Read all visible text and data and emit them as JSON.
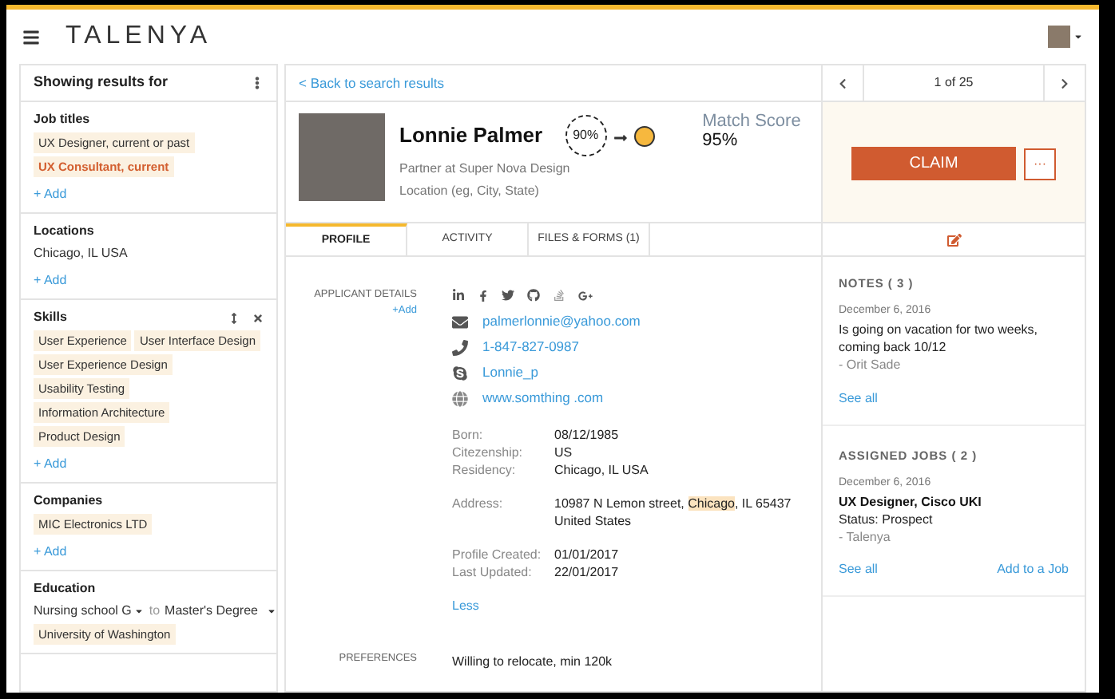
{
  "header": {
    "logo": "TALENYA"
  },
  "filters": {
    "title": "Showing results for",
    "sections": [
      {
        "title": "Job titles",
        "chips": [
          {
            "label": "UX Designer, current or past",
            "highlighted": false
          },
          {
            "label": "UX Consultant, current",
            "highlighted": true
          }
        ],
        "add": "+ Add"
      },
      {
        "title": "Locations",
        "values": [
          "Chicago, IL USA"
        ],
        "add": "+ Add"
      },
      {
        "title": "Skills",
        "tools": true,
        "chips": [
          {
            "label": "User Experience",
            "highlighted": false
          },
          {
            "label": "User Interface Design",
            "highlighted": false
          },
          {
            "label": "User Experience Design",
            "highlighted": false
          },
          {
            "label": "Usability Testing",
            "highlighted": false
          },
          {
            "label": "Information Architecture",
            "highlighted": false
          },
          {
            "label": "Product Design",
            "highlighted": false
          }
        ],
        "add": "+ Add"
      },
      {
        "title": "Companies",
        "chips": [
          {
            "label": "MIC Electronics LTD",
            "highlighted": false
          }
        ],
        "add": "+ Add"
      },
      {
        "title": "Education",
        "range": {
          "from": "Nursing school G",
          "to_label": "to",
          "to": "Master's Degree"
        },
        "chips": [
          {
            "label": "University of Washington",
            "highlighted": false
          }
        ]
      }
    ]
  },
  "profile": {
    "back": "< Back to search results",
    "name": "Lonnie Palmer",
    "subtitle": "Partner at Super Nova Design",
    "location": "Location (eg, City, State)",
    "match_from": "90%",
    "match_label": "Match Score",
    "match_value": "95%",
    "tabs": [
      {
        "label": "PROFILE",
        "selected": true
      },
      {
        "label": "ACTIVITY",
        "selected": false
      },
      {
        "label": "FILES & FORMS (1)",
        "selected": false
      }
    ],
    "details_label": "APPLICANT DETAILS",
    "details_add": "+Add",
    "contacts": [
      {
        "kind": "email",
        "value": "palmerlonnie@yahoo.com"
      },
      {
        "kind": "phone",
        "value": "1-847-827-0987"
      },
      {
        "kind": "skype",
        "value": "Lonnie_p"
      },
      {
        "kind": "web",
        "value": "www.somthing .com"
      }
    ],
    "facts": [
      [
        {
          "label": "Born:",
          "value": "08/12/1985"
        },
        {
          "label": "Citezenship:",
          "value": "US"
        },
        {
          "label": "Residency:",
          "value": "Chicago, IL USA"
        }
      ],
      [
        {
          "label": "Address:",
          "value": "10987 N Lemon street, ",
          "highlight": "Chicago",
          "rest": ", IL 65437",
          "line2": "United States"
        }
      ],
      [
        {
          "label": "Profile Created:",
          "value": "01/01/2017"
        },
        {
          "label": "Last Updated:",
          "value": "22/01/2017"
        }
      ]
    ],
    "less": "Less",
    "preferences_label": "PREFERENCES",
    "preferences": "Willing to relocate, min 120k"
  },
  "side": {
    "pager": "1 of 25",
    "claim": "CLAIM",
    "more": "···",
    "notes": {
      "title": "NOTES ( 3 )",
      "date": "December 6, 2016",
      "text": "Is going on vacation for two weeks, coming back 10/12",
      "author": "- Orit Sade",
      "link": "See all"
    },
    "jobs": {
      "title": "ASSIGNED JOBS ( 2 )",
      "date": "December 6, 2016",
      "job": "UX Designer, Cisco UKI",
      "status": "Status: Prospect",
      "author": "- Talenya",
      "link": "See all",
      "add": "Add to a Job"
    }
  }
}
